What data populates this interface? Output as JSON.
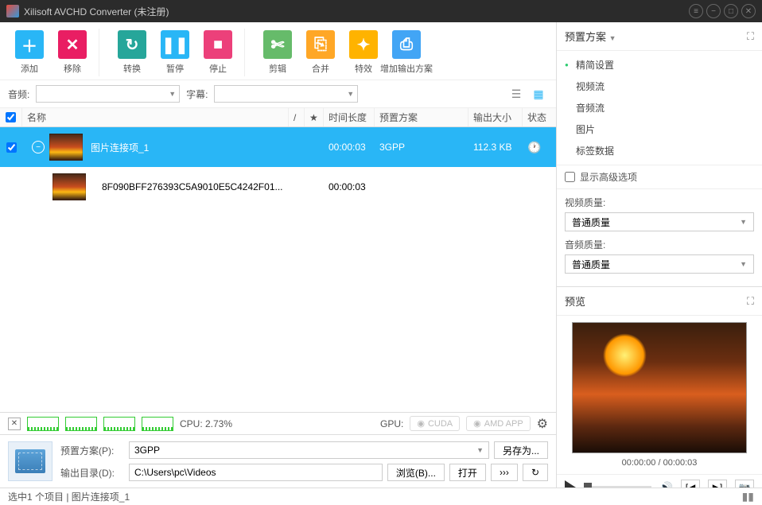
{
  "titlebar": {
    "title": "Xilisoft AVCHD Converter (未注册)"
  },
  "toolbar": {
    "add": "添加",
    "remove": "移除",
    "convert": "转换",
    "pause": "暂停",
    "stop": "停止",
    "clip": "剪辑",
    "merge": "合并",
    "effect": "特效",
    "addoutput": "增加输出方案"
  },
  "filter": {
    "audio": "音频:",
    "subtitle": "字幕:"
  },
  "columns": {
    "name": "名称",
    "time": "时间长度",
    "preset": "预置方案",
    "size": "输出大小",
    "status": "状态"
  },
  "rows": {
    "parent": {
      "name": "图片连接项_1",
      "time": "00:00:03",
      "preset": "3GPP",
      "size": "112.3 KB"
    },
    "child": {
      "name": "8F090BFF276393C5A9010E5C4242F01...",
      "time": "00:00:03"
    }
  },
  "perf": {
    "cpu_label": "CPU: 2.73%",
    "gpu_label": "GPU:",
    "cuda": "CUDA",
    "amd": "AMD APP"
  },
  "output": {
    "preset_label": "预置方案(P):",
    "preset_value": "3GPP",
    "dir_label": "输出目录(D):",
    "dir_value": "C:\\Users\\pc\\Videos",
    "saveas": "另存为...",
    "browse": "浏览(B)...",
    "open": "打开"
  },
  "right": {
    "preset_title": "预置方案",
    "items": {
      "simple": "精简设置",
      "video": "视频流",
      "audio": "音频流",
      "image": "图片",
      "tags": "标签数据"
    },
    "advanced": "显示高级选项",
    "vq_label": "视频质量:",
    "vq_value": "普通质量",
    "aq_label": "音频质量:",
    "aq_value": "普通质量",
    "preview_title": "预览",
    "preview_time": "00:00:00 / 00:00:03"
  },
  "status": {
    "text": "选中1 个项目 | 图片连接项_1"
  }
}
